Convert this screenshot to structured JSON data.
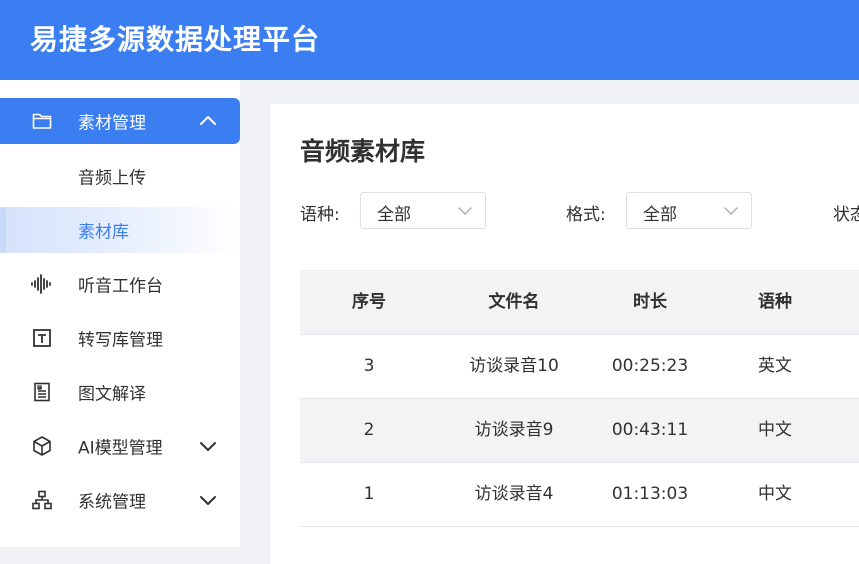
{
  "app": {
    "title": "易捷多源数据处理平台"
  },
  "sidebar": {
    "items": [
      {
        "label": "素材管理",
        "icon": "folder-icon",
        "expanded": true
      },
      {
        "label": "听音工作台",
        "icon": "audio-wave-icon"
      },
      {
        "label": "转写库管理",
        "icon": "text-box-icon"
      },
      {
        "label": "图文解译",
        "icon": "document-icon"
      },
      {
        "label": "AI模型管理",
        "icon": "cube-icon"
      },
      {
        "label": "系统管理",
        "icon": "org-chart-icon"
      }
    ],
    "submenu": [
      {
        "label": "音频上传"
      },
      {
        "label": "素材库"
      }
    ]
  },
  "main": {
    "title": "音频素材库",
    "filters": {
      "language": {
        "label": "语种:",
        "value": "全部"
      },
      "format": {
        "label": "格式:",
        "value": "全部"
      },
      "status": {
        "label": "状态"
      }
    },
    "table": {
      "headers": [
        "序号",
        "文件名",
        "时长",
        "语种"
      ],
      "rows": [
        [
          "3",
          "访谈录音10",
          "00:25:23",
          "英文"
        ],
        [
          "2",
          "访谈录音9",
          "00:43:11",
          "中文"
        ],
        [
          "1",
          "访谈录音4",
          "01:13:03",
          "中文"
        ]
      ]
    }
  },
  "colors": {
    "primary": "#3a7ef1",
    "background": "#f0f2f5"
  }
}
